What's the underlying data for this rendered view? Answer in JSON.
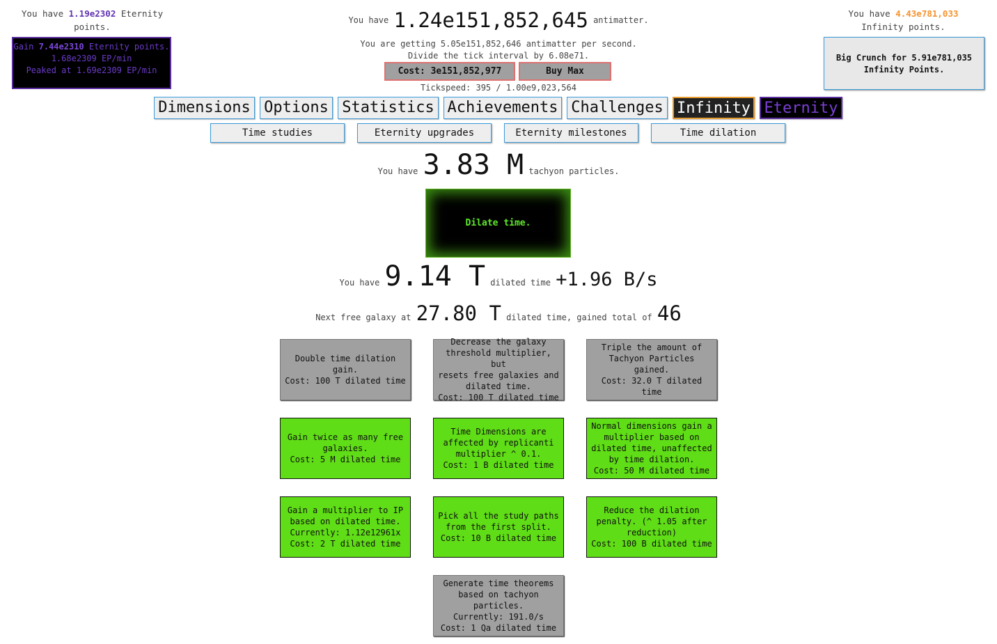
{
  "eternity": {
    "you_have_prefix": "You have ",
    "points": "1.19e2302",
    "points_suffix": " Eternity points.",
    "button": {
      "gain_prefix": "Gain ",
      "gain_value": "7.44e2310",
      "gain_suffix": " Eternity points.",
      "rate": "1.68e2309 EP/min",
      "peak": "Peaked at 1.69e2309 EP/min"
    }
  },
  "infinity": {
    "you_have_prefix": "You have ",
    "points": "4.43e781,033",
    "points_suffix": " Infinity points.",
    "crunch_button": "Big Crunch for 5.91e781,035 Infinity Points."
  },
  "antimatter": {
    "prefix": "You have ",
    "amount": "1.24e151,852,645",
    "suffix": " antimatter.",
    "rate": "You are getting 5.05e151,852,646 antimatter per second.",
    "tick_divide": "Divide the tick interval by 6.08e71.",
    "tick_cost_button": "Cost: 3e151,852,977",
    "buy_max_button": "Buy Max",
    "tickspeed": "Tickspeed: 395 / 1.00e9,023,564"
  },
  "tabs": [
    {
      "label": "Dimensions"
    },
    {
      "label": "Options"
    },
    {
      "label": "Statistics"
    },
    {
      "label": "Achievements"
    },
    {
      "label": "Challenges"
    },
    {
      "label": "Infinity"
    },
    {
      "label": "Eternity"
    }
  ],
  "subtabs": [
    {
      "label": "Time studies"
    },
    {
      "label": "Eternity upgrades"
    },
    {
      "label": "Eternity milestones"
    },
    {
      "label": "Time dilation"
    }
  ],
  "dilation": {
    "tachyon_prefix": "You have ",
    "tachyon_amount": "3.83 M",
    "tachyon_suffix": " tachyon particles.",
    "dilate_button": "Dilate time.",
    "dt_prefix": "You have ",
    "dt_amount": "9.14 T",
    "dt_mid": " dilated time ",
    "dt_rate": "+1.96 B/s",
    "galaxy_prefix": "Next free galaxy at ",
    "galaxy_threshold": "27.80 T",
    "galaxy_mid": " dilated time, gained total of ",
    "galaxy_total": "46",
    "upgrades": [
      {
        "lines": [
          "Double time dilation",
          "gain.",
          "Cost: 100 T dilated time"
        ],
        "state": "unaffordable"
      },
      {
        "lines": [
          "Decrease the galaxy",
          "threshold multiplier, but",
          "resets free galaxies and",
          "dilated time.",
          "Cost: 100 T dilated time"
        ],
        "state": "unaffordable"
      },
      {
        "lines": [
          "Triple the amount of",
          "Tachyon Particles gained.",
          "Cost: 32.0 T dilated time"
        ],
        "state": "unaffordable"
      },
      {
        "lines": [
          "Gain twice as many free",
          "galaxies.",
          "Cost: 5 M dilated time"
        ],
        "state": "bought"
      },
      {
        "lines": [
          "Time Dimensions are",
          "affected by replicanti",
          "multiplier ^ 0.1.",
          "Cost: 1 B dilated time"
        ],
        "state": "bought"
      },
      {
        "lines": [
          "Normal dimensions gain a",
          "multiplier based on",
          "dilated time, unaffected",
          "by time dilation.",
          "Cost: 50 M dilated time"
        ],
        "state": "bought"
      },
      {
        "lines": [
          "Gain a multiplier to IP",
          "based on dilated time.",
          "Currently: 1.12e12961x",
          "Cost: 2 T dilated time"
        ],
        "state": "bought"
      },
      {
        "lines": [
          "Pick all the study paths",
          "from the first split.",
          "Cost: 10 B dilated time"
        ],
        "state": "bought"
      },
      {
        "lines": [
          "Reduce the dilation",
          "penalty. (^ 1.05 after",
          "reduction)",
          "Cost: 100 B dilated time"
        ],
        "state": "bought"
      },
      {
        "lines": [
          "Generate time theorems",
          "based on tachyon",
          "particles.",
          "Currently: 191.0/s",
          "Cost: 1 Qa dilated time"
        ],
        "state": "unaffordable"
      }
    ]
  }
}
